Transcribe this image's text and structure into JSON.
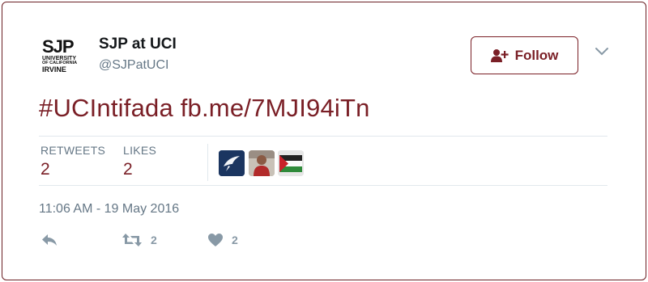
{
  "account": {
    "display_name": "SJP at UCI",
    "handle": "@SJPatUCI",
    "avatar_text": {
      "big": "SJP",
      "line1": "UNIVERSITY",
      "line2": "OF CALIFORNIA",
      "line3": "IRVINE"
    }
  },
  "follow_button": {
    "label": "Follow",
    "icon": "add-user-icon"
  },
  "more_menu": {
    "icon": "chevron-down-icon"
  },
  "tweet": {
    "hashtag": "#UCIntifada",
    "link": "fb.me/7MJI94iTn"
  },
  "stats": {
    "retweets_label": "RETWEETS",
    "retweets_count": "2",
    "likes_label": "LIKES",
    "likes_count": "2"
  },
  "likers": [
    {
      "icon": "bird-avatar"
    },
    {
      "icon": "person-avatar"
    },
    {
      "icon": "flag-avatar"
    }
  ],
  "timestamp": "11:06 AM - 19 May 2016",
  "actions": {
    "reply_icon": "reply-icon",
    "retweet_icon": "retweet-icon",
    "retweet_count": "2",
    "like_icon": "heart-icon",
    "like_count": "2"
  },
  "colors": {
    "accent": "#7a1f26",
    "muted": "#657786",
    "action_gray": "#8899a6"
  }
}
